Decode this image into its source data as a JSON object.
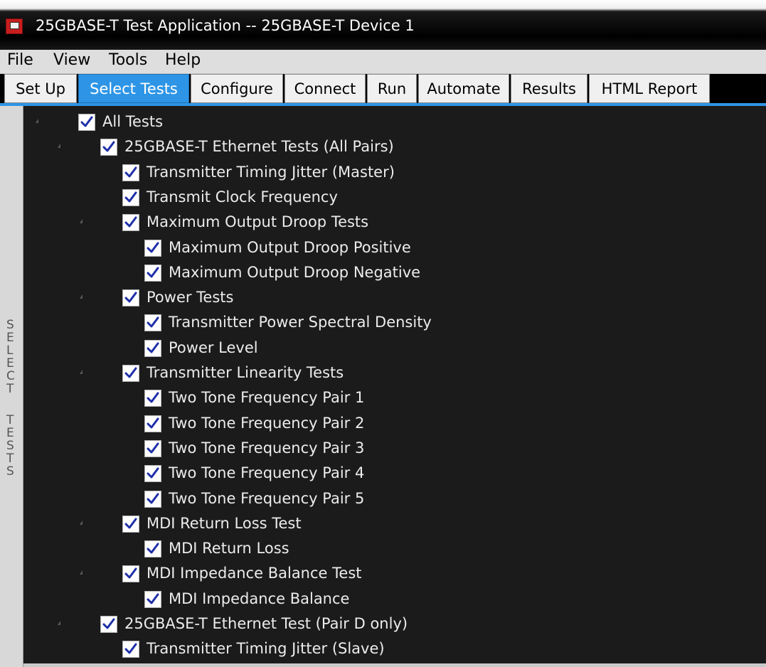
{
  "window": {
    "title": "25GBASE-T Test Application -- 25GBASE-T Device 1",
    "icon": "app-icon"
  },
  "menubar": {
    "items": [
      "File",
      "View",
      "Tools",
      "Help"
    ]
  },
  "tabs": [
    {
      "label": "Set Up",
      "active": false
    },
    {
      "label": "Select Tests",
      "active": true
    },
    {
      "label": "Configure",
      "active": false
    },
    {
      "label": "Connect",
      "active": false
    },
    {
      "label": "Run",
      "active": false
    },
    {
      "label": "Automate",
      "active": false
    },
    {
      "label": "Results",
      "active": false
    },
    {
      "label": "HTML Report",
      "active": false
    }
  ],
  "side_label": "SELECT TESTS",
  "tree": {
    "items": [
      {
        "label": "All Tests",
        "level": 0,
        "checked": true,
        "expandable": true
      },
      {
        "label": "25GBASE-T Ethernet Tests (All Pairs)",
        "level": 1,
        "checked": true,
        "expandable": true
      },
      {
        "label": "Transmitter Timing Jitter (Master)",
        "level": 2,
        "checked": true,
        "expandable": false
      },
      {
        "label": "Transmit Clock Frequency",
        "level": 2,
        "checked": true,
        "expandable": false
      },
      {
        "label": "Maximum Output Droop Tests",
        "level": 2,
        "checked": true,
        "expandable": true
      },
      {
        "label": "Maximum Output Droop Positive",
        "level": 3,
        "checked": true,
        "expandable": false
      },
      {
        "label": "Maximum Output Droop Negative",
        "level": 3,
        "checked": true,
        "expandable": false
      },
      {
        "label": "Power Tests",
        "level": 2,
        "checked": true,
        "expandable": true
      },
      {
        "label": "Transmitter Power Spectral Density",
        "level": 3,
        "checked": true,
        "expandable": false
      },
      {
        "label": "Power Level",
        "level": 3,
        "checked": true,
        "expandable": false
      },
      {
        "label": "Transmitter Linearity Tests",
        "level": 2,
        "checked": true,
        "expandable": true
      },
      {
        "label": "Two Tone Frequency Pair 1",
        "level": 3,
        "checked": true,
        "expandable": false
      },
      {
        "label": "Two Tone Frequency Pair 2",
        "level": 3,
        "checked": true,
        "expandable": false
      },
      {
        "label": "Two Tone Frequency Pair 3",
        "level": 3,
        "checked": true,
        "expandable": false
      },
      {
        "label": "Two Tone Frequency Pair 4",
        "level": 3,
        "checked": true,
        "expandable": false
      },
      {
        "label": "Two Tone Frequency Pair 5",
        "level": 3,
        "checked": true,
        "expandable": false
      },
      {
        "label": "MDI Return Loss Test",
        "level": 2,
        "checked": true,
        "expandable": true
      },
      {
        "label": "MDI Return Loss",
        "level": 3,
        "checked": true,
        "expandable": false
      },
      {
        "label": "MDI Impedance Balance Test",
        "level": 2,
        "checked": true,
        "expandable": true
      },
      {
        "label": "MDI Impedance Balance",
        "level": 3,
        "checked": true,
        "expandable": false
      },
      {
        "label": "25GBASE-T Ethernet Test (Pair D only)",
        "level": 1,
        "checked": true,
        "expandable": true
      },
      {
        "label": "Transmitter Timing Jitter (Slave)",
        "level": 2,
        "checked": true,
        "expandable": false
      }
    ]
  },
  "colors": {
    "active_tab": "#2e95e6",
    "tree_background": "#1b1b1b",
    "tree_text": "#ececec",
    "checkmark": "#1e2fa8",
    "title_bar": "#000000"
  }
}
